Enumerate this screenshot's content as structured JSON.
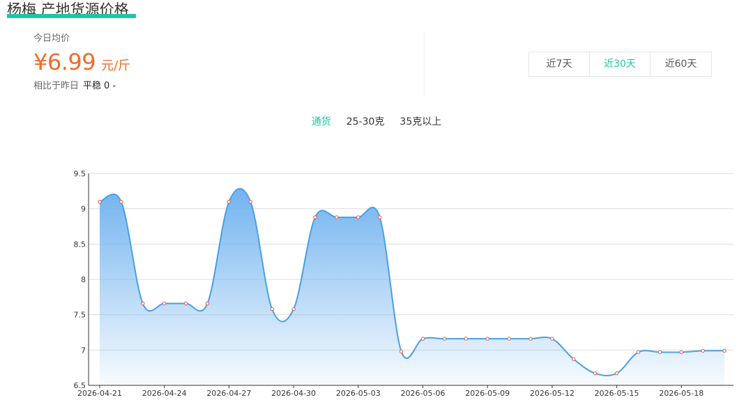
{
  "header": {
    "title": "杨梅 产地货源价格"
  },
  "summary": {
    "today_label": "今日均价",
    "price": "¥6.99",
    "unit": "元/斤",
    "compare_label": "相比于昨日",
    "compare_status": "平稳",
    "compare_change": "0 -"
  },
  "range_tabs": [
    {
      "label": "近7天",
      "active": false
    },
    {
      "label": "近30天",
      "active": true
    },
    {
      "label": "近60天",
      "active": false
    }
  ],
  "grade_tabs": [
    {
      "label": "通货",
      "active": true
    },
    {
      "label": "25-30克",
      "active": false
    },
    {
      "label": "35克以上",
      "active": false
    }
  ],
  "colors": {
    "accent": "#1dc8a0",
    "price": "#f26a2a",
    "line": "#4a9fe3",
    "marker": "#e0584a"
  },
  "chart_data": {
    "type": "area",
    "x": [
      "2026-04-21",
      "2026-04-22",
      "2026-04-23",
      "2026-04-24",
      "2026-04-25",
      "2026-04-26",
      "2026-04-27",
      "2026-04-28",
      "2026-04-29",
      "2026-04-30",
      "2026-05-01",
      "2026-05-02",
      "2026-05-03",
      "2026-05-04",
      "2026-05-05",
      "2026-05-06",
      "2026-05-07",
      "2026-05-08",
      "2026-05-09",
      "2026-05-10",
      "2026-05-11",
      "2026-05-12",
      "2026-05-13",
      "2026-05-14",
      "2026-05-15",
      "2026-05-16",
      "2026-05-17",
      "2026-05-18",
      "2026-05-19",
      "2026-05-20"
    ],
    "series": [
      {
        "values": [
          9.1,
          9.1,
          7.66,
          7.66,
          7.66,
          7.66,
          9.1,
          9.1,
          7.58,
          7.58,
          8.88,
          8.88,
          8.88,
          8.88,
          6.98,
          7.16,
          7.16,
          7.16,
          7.16,
          7.16,
          7.16,
          7.16,
          6.87,
          6.67,
          6.67,
          6.97,
          6.97,
          6.97,
          6.99,
          6.99
        ]
      }
    ],
    "x_tick_labels": [
      "2026-04-21",
      "2026-04-24",
      "2026-04-27",
      "2026-04-30",
      "2026-05-03",
      "2026-05-06",
      "2026-05-09",
      "2026-05-12",
      "2026-05-15",
      "2026-05-18"
    ],
    "y_ticks": [
      6.5,
      7,
      7.5,
      8,
      8.5,
      9,
      9.5
    ],
    "y_tick_labels": [
      "6.5",
      "7",
      "7.5",
      "8",
      "8.5",
      "9",
      "9.5"
    ],
    "ylim": [
      6.5,
      9.5
    ],
    "grid": true,
    "legend": "none",
    "markers": true,
    "smooth": true
  }
}
